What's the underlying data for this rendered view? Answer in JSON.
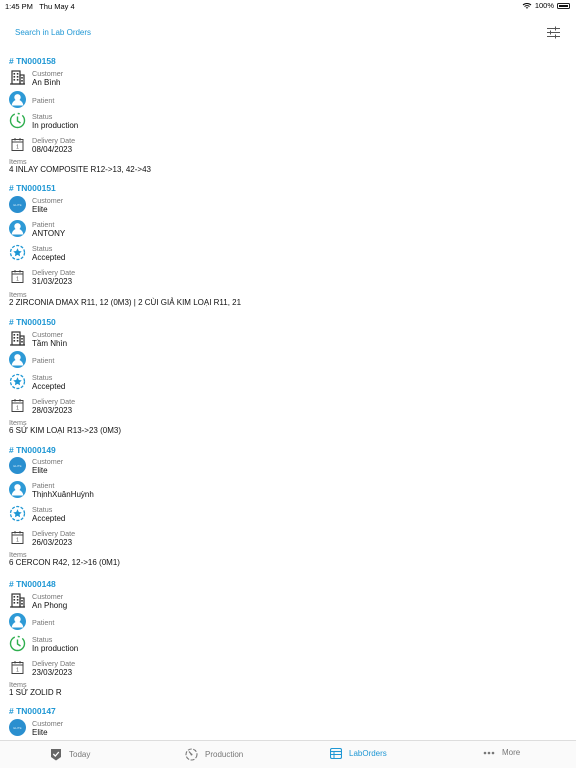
{
  "status_bar": {
    "time": "1:45 PM",
    "date": "Thu May 4",
    "battery": "100%"
  },
  "search": {
    "placeholder": "Search in Lab Orders"
  },
  "labels": {
    "customer": "Customer",
    "patient": "Patient",
    "status": "Status",
    "delivery": "Delivery Date",
    "items": "Items"
  },
  "orders": [
    {
      "code": "# TN000158",
      "customer": "An Bình",
      "customer_icon": "building-icon",
      "patient": "",
      "status": "In production",
      "status_icon": "clock-icon",
      "delivery": "08/04/2023",
      "items": "4 INLAY COMPOSITE R12->13, 42->43"
    },
    {
      "code": "# TN000151",
      "customer": "Elite",
      "customer_icon": "elite-logo",
      "patient": "ANTONY",
      "status": "Accepted",
      "status_icon": "star-badge-icon",
      "delivery": "31/03/2023",
      "items": "2 ZIRCONIA DMAX R11, 12 (0M3) | 2 CÙI GIẢ KIM LOẠI  R11, 21"
    },
    {
      "code": "# TN000150",
      "customer": "Tầm Nhìn",
      "customer_icon": "building-icon",
      "patient": "",
      "status": "Accepted",
      "status_icon": "star-badge-icon",
      "delivery": "28/03/2023",
      "items": "6 SỨ KIM LOẠI R13->23 (0M3)"
    },
    {
      "code": "# TN000149",
      "customer": "Elite",
      "customer_icon": "elite-logo",
      "patient": "ThịnhXuânHuỳnh",
      "status": "Accepted",
      "status_icon": "star-badge-icon",
      "delivery": "26/03/2023",
      "items": "6 CERCON R42, 12->16 (0M1)"
    },
    {
      "code": "# TN000148",
      "customer": "An Phong",
      "customer_icon": "building-icon",
      "patient": "",
      "status": "In production",
      "status_icon": "clock-icon",
      "delivery": "23/03/2023",
      "items": "1 SỨ ZOLID R"
    },
    {
      "code": "# TN000147",
      "customer": "Elite",
      "customer_icon": "elite-logo"
    }
  ],
  "elite_logo_text": "ELITE",
  "tabs": [
    {
      "label": "Today",
      "icon": "checkmark-shield-icon"
    },
    {
      "label": "Production",
      "icon": "production-gauge-icon"
    },
    {
      "label": "LabOrders",
      "icon": "lab-orders-icon",
      "active": true
    },
    {
      "label": "More",
      "icon": "more-dots-icon"
    }
  ],
  "colors": {
    "accent": "#1f97d4",
    "production_green": "#2eae4e",
    "label_gray": "#777777"
  }
}
